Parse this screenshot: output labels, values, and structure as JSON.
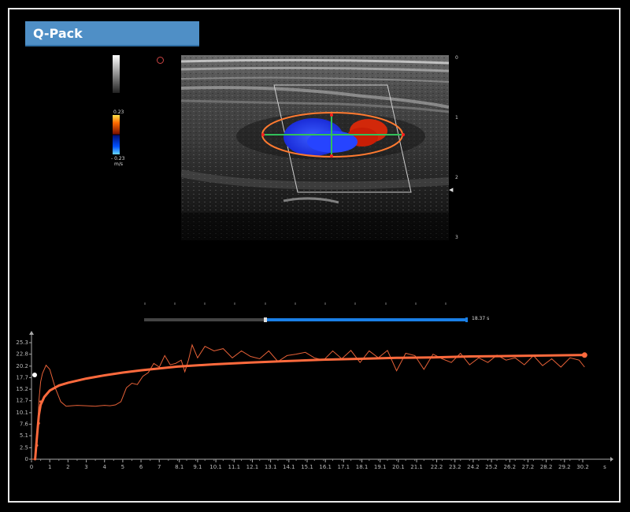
{
  "app": {
    "title": "Q-Pack"
  },
  "color_scale": {
    "max_label": "0.23",
    "min_label": "- 0.23",
    "unit": "m/s"
  },
  "depth_scale": {
    "labels": [
      "0",
      "1",
      "2",
      "3"
    ]
  },
  "timeline": {
    "time_label": "18.37 s",
    "position_fraction": 0.375
  },
  "colors": {
    "curve": "#ff6a3d",
    "fit": "#ff6a3d",
    "track": "#1a7fe6",
    "title_bg": "#4f8fc6"
  },
  "chart_data": {
    "type": "line",
    "title": "",
    "xlabel": "",
    "ylabel": "",
    "y_ticks": [
      "0",
      "2.5",
      "5.1",
      "7.6",
      "10.1",
      "12.7",
      "15.2",
      "17.7",
      "20.2",
      "22.8",
      "25.3"
    ],
    "x_ticks": [
      "0",
      "1",
      "2",
      "3",
      "4",
      "5",
      "6",
      "7",
      "8.1",
      "9.1",
      "10.1",
      "11.1",
      "12.1",
      "13.1",
      "14.1",
      "15.1",
      "16.1",
      "17.1",
      "18.1",
      "19.1",
      "20.1",
      "21.1",
      "22.2",
      "23.2",
      "24.2",
      "25.2",
      "26.2",
      "27.2",
      "28.2",
      "29.2",
      "30.2"
    ],
    "x_axis_end_label": "s",
    "xlim": [
      0,
      31.5
    ],
    "ylim": [
      0,
      27.5
    ],
    "series": [
      {
        "x": [
          0,
          0.2,
          0.3,
          0.35,
          0.4,
          0.5,
          0.6,
          0.8,
          1.0,
          1.3,
          1.6,
          1.9,
          2.2,
          2.5,
          3.0,
          3.5,
          4.0,
          4.3,
          4.6,
          4.9,
          5.2,
          5.5,
          5.8,
          6.1,
          6.4,
          6.7,
          7.0,
          7.3,
          7.6,
          7.9,
          8.2,
          8.4,
          8.6,
          8.8,
          9.1,
          9.5,
          10.0,
          10.5,
          11.0,
          11.5,
          12.0,
          12.5,
          13.0,
          13.5,
          14.0,
          14.5,
          15.0,
          15.5,
          16.0,
          16.5,
          17.0,
          17.5,
          18.0,
          18.5,
          19.0,
          19.5,
          20.0,
          20.5,
          21.0,
          21.5,
          22.0,
          22.5,
          23.0,
          23.5,
          24.0,
          24.5,
          25.0,
          25.5,
          26.0,
          26.5,
          27.0,
          27.5,
          28.0,
          28.5,
          29.0,
          29.5,
          30.0,
          30.3
        ],
        "y": [
          0,
          0,
          3,
          7.8,
          12.5,
          16.8,
          18.6,
          20.4,
          19.5,
          15.5,
          12.5,
          11.5,
          11.6,
          11.7,
          11.6,
          11.5,
          11.7,
          11.6,
          11.8,
          12.5,
          15.5,
          16.5,
          16.2,
          18.0,
          18.8,
          20.8,
          20.0,
          22.5,
          20.5,
          20.8,
          21.5,
          19.0,
          21.5,
          24.8,
          22.0,
          24.5,
          23.5,
          24.0,
          22.0,
          23.5,
          22.3,
          21.8,
          23.5,
          21.2,
          22.5,
          22.8,
          23.2,
          22.0,
          21.5,
          23.5,
          21.8,
          23.6,
          21.0,
          23.5,
          22.0,
          23.6,
          19.2,
          23.0,
          22.5,
          19.5,
          22.8,
          21.8,
          21.0,
          23.0,
          20.5,
          22.0,
          21.0,
          22.6,
          21.5,
          22.0,
          20.5,
          22.5,
          20.3,
          21.8,
          20.0,
          22.0,
          21.5,
          20.0
        ]
      },
      {
        "name": "",
        "x": [
          0.2,
          0.3,
          0.4,
          0.5,
          0.7,
          1.0,
          1.5,
          2.0,
          3.0,
          4.0,
          5.0,
          6.0,
          7.0,
          8.0,
          10.0,
          12.0,
          14.0,
          16.0,
          18.0,
          20.0,
          22.0,
          24.0,
          26.0,
          28.0,
          30.0,
          30.3
        ],
        "y": [
          0,
          5.0,
          9.5,
          11.8,
          13.5,
          14.9,
          16.0,
          16.6,
          17.5,
          18.2,
          18.8,
          19.3,
          19.7,
          20.1,
          20.6,
          21.0,
          21.3,
          21.6,
          21.8,
          22.0,
          22.1,
          22.3,
          22.4,
          22.5,
          22.6,
          22.6
        ]
      }
    ]
  }
}
